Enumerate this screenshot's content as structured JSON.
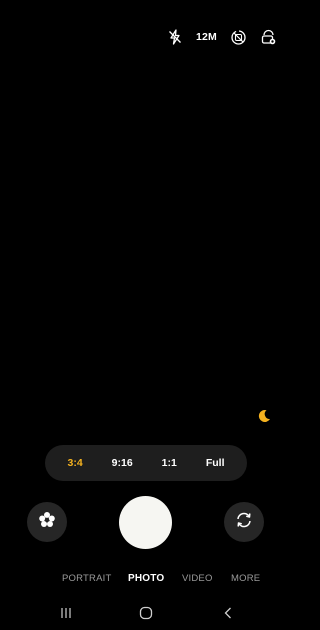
{
  "top_bar": {
    "flash_icon": "flash-off-icon",
    "resolution": "12M",
    "timer_icon": "motion-photo-icon",
    "settings_icon": "filter-icon"
  },
  "night_mode_icon": "moon-icon",
  "aspect_ratios": [
    {
      "label": "3:4",
      "active": true
    },
    {
      "label": "9:16",
      "active": false
    },
    {
      "label": "1:1",
      "active": false
    },
    {
      "label": "Full",
      "active": false
    }
  ],
  "controls": {
    "effects_icon": "flower-effects-icon",
    "shutter": "shutter-button",
    "switch_icon": "switch-camera-icon"
  },
  "modes": [
    {
      "label": "PORTRAIT",
      "active": false
    },
    {
      "label": "PHOTO",
      "active": true
    },
    {
      "label": "VIDEO",
      "active": false
    },
    {
      "label": "MORE",
      "active": false
    }
  ],
  "nav": {
    "recents_icon": "recents-icon",
    "home_icon": "home-icon",
    "back_icon": "back-icon"
  },
  "colors": {
    "accent": "#f5b21f",
    "background": "#000000",
    "pill": "#1e1e1e",
    "shutter": "#f6f6f2"
  }
}
